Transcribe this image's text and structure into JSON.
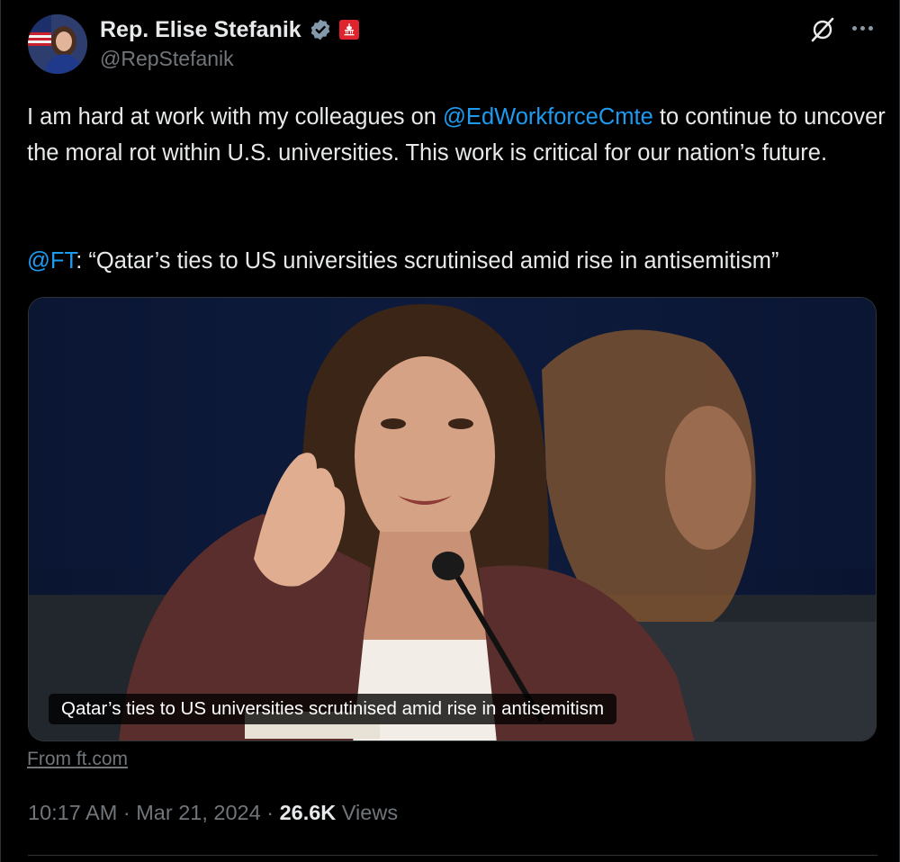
{
  "author": {
    "name": "Rep. Elise Stefanik",
    "handle": "@RepStefanik",
    "verified": true,
    "affiliation_badge_color": "#e0242e"
  },
  "tweet": {
    "line1_pre": "I am hard at work with my colleagues on ",
    "line1_mention": "@EdWorkforceCmte",
    "line1_post": " to continue to uncover the moral rot within U.S. universities. This work is critical for our nation’s future.",
    "quote_mention": "@FT",
    "quote_text": ": “Qatar’s ties to US universities scrutinised amid rise in antisemitism”"
  },
  "card": {
    "caption": "Qatar’s ties to US universities scrutinised amid rise in antisemitism",
    "source": "From ft.com"
  },
  "meta": {
    "time": "10:17 AM",
    "sep1": " · ",
    "date": "Mar 21, 2024",
    "sep2": " · ",
    "views_count": "26.6K",
    "views_label": " Views"
  },
  "icons": {
    "more": "more-icon",
    "grok": "grok-icon",
    "verified": "verified-badge-icon",
    "gov": "capitol-badge-icon"
  },
  "colors": {
    "accent": "#1d9bf0",
    "muted": "#71767b",
    "text": "#e7e9ea",
    "background": "#000000"
  }
}
